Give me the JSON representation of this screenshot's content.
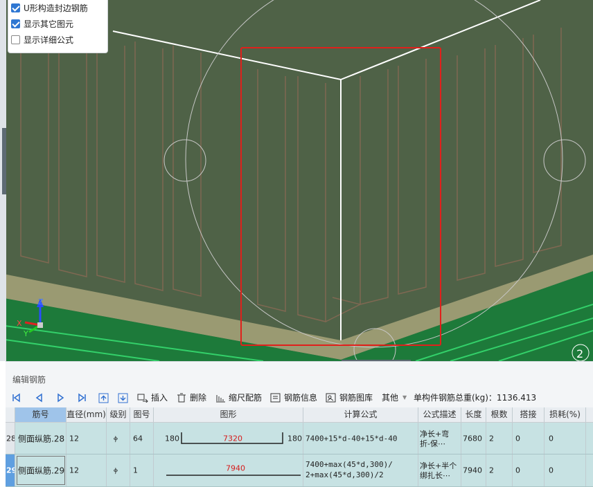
{
  "options": {
    "items": [
      {
        "label": "U形构造封边钢筋",
        "checked": true
      },
      {
        "label": "显示其它图元",
        "checked": true
      },
      {
        "label": "显示详细公式",
        "checked": false
      }
    ]
  },
  "viewport": {
    "background": "#4f6247",
    "axes": {
      "z": "Z",
      "x": "X",
      "y": "Y"
    },
    "corner_number": "2"
  },
  "panel": {
    "title": "编辑钢筋",
    "toolbar": {
      "insert": "插入",
      "delete": "删除",
      "scale_rebar": "缩尺配筋",
      "rebar_info": "钢筋信息",
      "rebar_library": "钢筋图库",
      "other": "其他",
      "total_weight": "单构件钢筋总重(kg)：1136.413"
    },
    "columns": [
      "筋号",
      "直径(mm)",
      "级别",
      "图号",
      "图形",
      "计算公式",
      "公式描述",
      "长度",
      "根数",
      "搭接",
      "损耗(%)"
    ],
    "rows": [
      {
        "row_no": "28",
        "name": "侧面纵筋.28",
        "diameter": "12",
        "grade": "ⲫ",
        "shape_no": "64",
        "shape_left": "180",
        "shape_mid": "7320",
        "shape_right": "180",
        "formula": "7400+15*d-40+15*d-40",
        "formula_line2": "",
        "desc": "净长+弯",
        "desc_line2": "折-保⋯",
        "length": "7680",
        "count": "2",
        "lap": "0",
        "loss": "0"
      },
      {
        "row_no": "29",
        "name": "侧面纵筋.29",
        "diameter": "12",
        "grade": "ⲫ",
        "shape_no": "1",
        "shape_left": "",
        "shape_mid": "7940",
        "shape_right": "",
        "formula": "7400+max(45*d,300)/",
        "formula_line2": "2+max(45*d,300)/2",
        "desc": "净长+半个",
        "desc_line2": "绑扎长⋯",
        "length": "7940",
        "count": "2",
        "lap": "0",
        "loss": "0"
      }
    ]
  },
  "colors": {
    "selection_red": "#e0201b",
    "row_bg": "#c7e2e3",
    "active_row": "#5f9fe0"
  }
}
